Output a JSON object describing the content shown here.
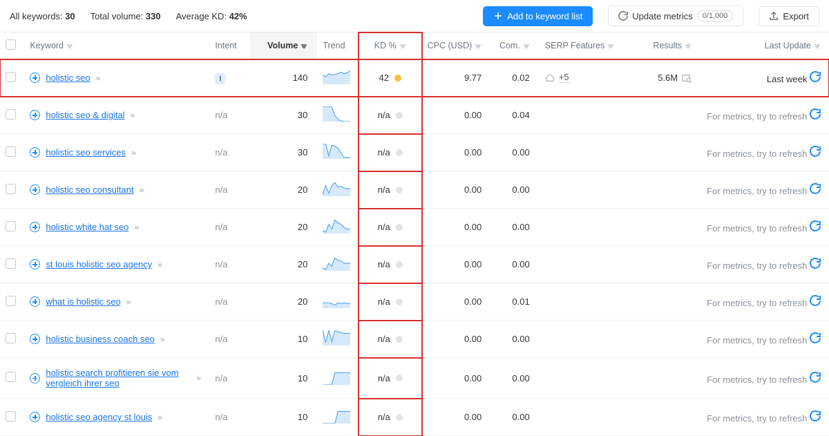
{
  "toolbar": {
    "all_keywords_label": "All keywords:",
    "all_keywords_value": "30",
    "total_volume_label": "Total volume:",
    "total_volume_value": "330",
    "avg_kd_label": "Average KD:",
    "avg_kd_value": "42%",
    "add_label": "Add to keyword list",
    "update_label": "Update metrics",
    "update_count": "0/1,000",
    "export_label": "Export"
  },
  "columns": {
    "keyword": "Keyword",
    "intent": "Intent",
    "volume": "Volume",
    "trend": "Trend",
    "kd": "KD %",
    "cpc": "CPC (USD)",
    "com": "Com.",
    "serp": "SERP Features",
    "results": "Results",
    "last_update": "Last Update"
  },
  "rows": [
    {
      "keyword": "holistic seo",
      "intent": "I",
      "volume": "140",
      "kd": "42",
      "kd_color": "orange",
      "cpc": "9.77",
      "com": "0.02",
      "serp_extra": "+5",
      "results": "5.6M",
      "last_update": "Last week",
      "highlight": true,
      "spark": [
        0.6,
        0.5,
        0.7,
        0.6,
        0.65,
        0.7,
        0.8,
        0.7,
        0.75,
        0.9
      ]
    },
    {
      "keyword": "holistic seo & digital",
      "intent": "n/a",
      "volume": "30",
      "kd": "n/a",
      "kd_color": "grey",
      "cpc": "0.00",
      "com": "0.04",
      "results": "",
      "last_update": "For metrics, try to refresh",
      "spark": [
        1,
        1,
        1,
        0.95,
        0.4,
        0.15,
        0.05,
        0,
        0,
        0
      ]
    },
    {
      "keyword": "holistic seo services",
      "intent": "n/a",
      "volume": "30",
      "kd": "n/a",
      "kd_color": "grey",
      "cpc": "0.00",
      "com": "0.00",
      "results": "",
      "last_update": "For metrics, try to refresh",
      "spark": [
        1,
        1,
        0.2,
        0.9,
        0.85,
        0.7,
        0.4,
        0.1,
        0.1,
        0.1
      ]
    },
    {
      "keyword": "holistic seo consultant",
      "intent": "n/a",
      "volume": "20",
      "kd": "n/a",
      "kd_color": "grey",
      "cpc": "0.00",
      "com": "0.00",
      "results": "",
      "last_update": "For metrics, try to refresh",
      "spark": [
        0.1,
        0.7,
        0.2,
        0.7,
        0.9,
        0.6,
        0.65,
        0.55,
        0.5,
        0.5
      ]
    },
    {
      "keyword": "holistic white hat seo",
      "intent": "n/a",
      "volume": "20",
      "kd": "n/a",
      "kd_color": "grey",
      "cpc": "0.00",
      "com": "0.00",
      "results": "",
      "last_update": "For metrics, try to refresh",
      "spark": [
        0.2,
        0.1,
        0.6,
        0.3,
        0.9,
        0.7,
        0.6,
        0.4,
        0.3,
        0.3
      ]
    },
    {
      "keyword": "st louis holistic seo agency",
      "intent": "n/a",
      "volume": "20",
      "kd": "n/a",
      "kd_color": "grey",
      "cpc": "0.00",
      "com": "0.00",
      "results": "",
      "last_update": "For metrics, try to refresh",
      "spark": [
        0.2,
        0.1,
        0.5,
        0.3,
        0.85,
        0.7,
        0.65,
        0.5,
        0.5,
        0.5
      ]
    },
    {
      "keyword": "what is holistic seo",
      "intent": "n/a",
      "volume": "20",
      "kd": "n/a",
      "kd_color": "grey",
      "cpc": "0.00",
      "com": "0.01",
      "results": "",
      "last_update": "For metrics, try to refresh",
      "spark": [
        0.35,
        0.35,
        0.35,
        0.3,
        0.2,
        0.35,
        0.3,
        0.35,
        0.3,
        0.3
      ]
    },
    {
      "keyword": "holistic business coach seo",
      "intent": "n/a",
      "volume": "10",
      "kd": "n/a",
      "kd_color": "grey",
      "cpc": "0.00",
      "com": "0.00",
      "results": "",
      "last_update": "For metrics, try to refresh",
      "spark": [
        1,
        0.2,
        1,
        0.25,
        1,
        0.9,
        0.85,
        0.8,
        0.8,
        0.8
      ]
    },
    {
      "keyword": "holistic search profitieren sie vom vergleich ihrer seo",
      "intent": "n/a",
      "volume": "10",
      "kd": "n/a",
      "kd_color": "grey",
      "cpc": "0.00",
      "com": "0.00",
      "results": "",
      "last_update": "For metrics, try to refresh",
      "spark": [
        0,
        0,
        0,
        0,
        0.8,
        0.8,
        0.8,
        0.8,
        0.8,
        0.8
      ]
    },
    {
      "keyword": "holistic seo agency st louis",
      "intent": "n/a",
      "volume": "10",
      "kd": "n/a",
      "kd_color": "grey",
      "cpc": "0.00",
      "com": "0.00",
      "results": "",
      "last_update": "For metrics, try to refresh",
      "spark": [
        0,
        0,
        0,
        0,
        0,
        0.8,
        0.8,
        0.8,
        0.8,
        0.8
      ]
    }
  ]
}
